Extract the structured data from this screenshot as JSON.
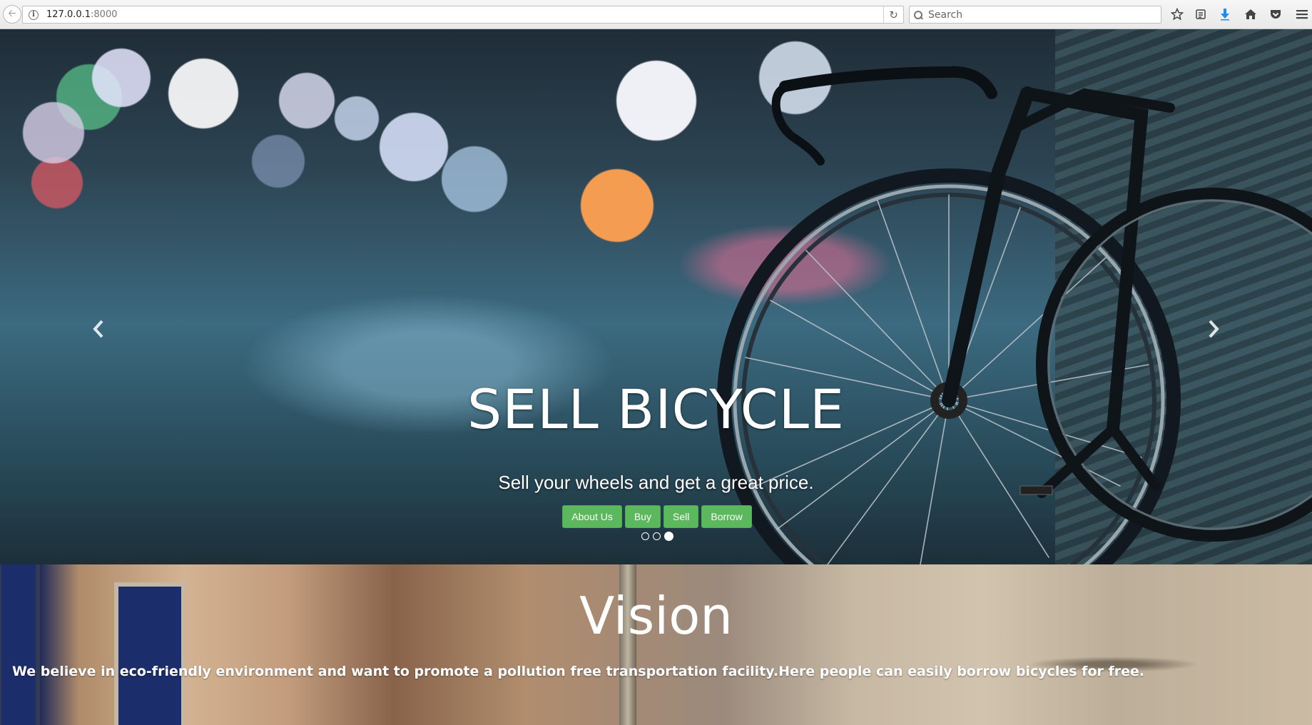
{
  "browser": {
    "url_host": "127.0.0.1",
    "url_port": ":8000",
    "search_placeholder": "Search",
    "icons": [
      "back-arrow-icon",
      "info-icon",
      "reload-icon",
      "search-icon",
      "bookmark-star-icon",
      "reading-list-icon",
      "download-icon",
      "home-icon",
      "pocket-icon",
      "menu-icon"
    ],
    "download_icon_color": "#1d8cf0"
  },
  "hero": {
    "title": "SELL BICYCLE",
    "subtitle": "Sell your wheels and get a great price.",
    "buttons": [
      "About Us",
      "Buy",
      "Sell",
      "Borrow"
    ],
    "button_color": "#5cb85c",
    "slide_count": 3,
    "active_slide": 3
  },
  "vision": {
    "title": "Vision",
    "text": "We believe in eco-friendly environment and want to promote a pollution free transportation facility.Here people can easily borrow bicycles for free."
  }
}
